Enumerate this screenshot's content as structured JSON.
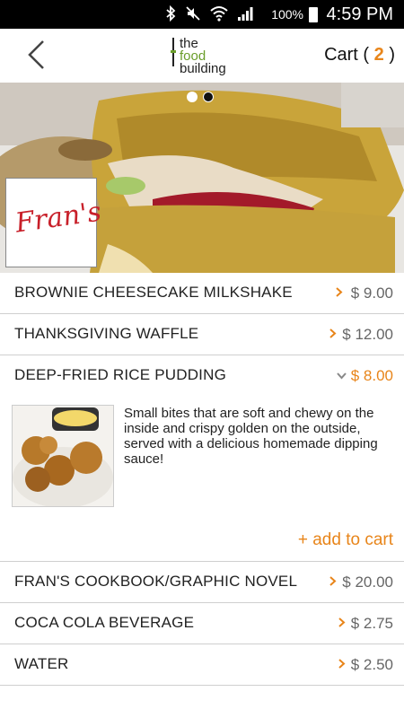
{
  "status_bar": {
    "battery": "100%",
    "time": "4:59 PM"
  },
  "header": {
    "logo_lines": [
      "the",
      "food",
      "building"
    ],
    "cart_label": "Cart (",
    "cart_count": "2",
    "cart_close": ")"
  },
  "carousel": {
    "page": 2,
    "pages": 2
  },
  "vendor_logo": "Fran's",
  "menu": {
    "items": [
      {
        "name": "BROWNIE CHEESECAKE MILKSHAKE",
        "price": "$ 9.00"
      },
      {
        "name": "THANKSGIVING WAFFLE",
        "price": "$ 12.00"
      },
      {
        "name": "DEEP-FRIED RICE PUDDING",
        "price": "$ 8.00"
      },
      {
        "name": "FRAN'S COOKBOOK/GRAPHIC NOVEL",
        "price": "$ 20.00"
      },
      {
        "name": "COCA COLA BEVERAGE",
        "price": "$ 2.75"
      },
      {
        "name": "WATER",
        "price": "$ 2.50"
      }
    ],
    "expanded_description": "Small bites that are soft and chewy on the inside and crispy golden on the outside, served with a delicious homemade dipping sauce!",
    "add_to_cart_label": "+ add to cart"
  },
  "colors": {
    "accent": "#e8851a",
    "logo_green": "#6a9d2a",
    "brand_red": "#c8202a"
  }
}
